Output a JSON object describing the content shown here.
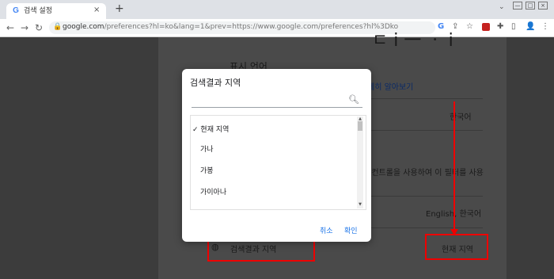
{
  "browser": {
    "tab_title": "검색 설정",
    "tab_favicon": "G",
    "close_glyph": "×",
    "new_tab_glyph": "+",
    "tab_search_glyph": "⌄",
    "window_controls": [
      "—",
      "□",
      "×"
    ],
    "nav": {
      "back": "←",
      "forward": "→",
      "reload": "↻"
    },
    "url_domain": "google.com",
    "url_rest": "/preferences?hl=ko&lang=1&prev=https://www.google.com/preferences?hl%3Dko",
    "toolbar_icons": [
      "G",
      "⇪",
      "☆",
      "❚",
      "✚",
      "▯",
      "👤",
      "⋮"
    ],
    "accent": "#1a73e8"
  },
  "page": {
    "heading_partial": "ㄷ ⅰ 一 ㆍ ⅰ",
    "section_label": "표시 언어",
    "learn_more": "세히 알아보기",
    "current_lang": "한국어",
    "filter_text": "e 컨트롤을 사용하여 이 필터를 사용",
    "search_langs": "English, 한국어",
    "region_label": "검색결과 지역",
    "region_value": "현재 지역"
  },
  "dialog": {
    "title": "검색결과 지역",
    "search_placeholder": "",
    "search_icon": "search-icon",
    "items": [
      {
        "label": "현재 지역",
        "checked": true
      },
      {
        "label": "가나",
        "checked": false
      },
      {
        "label": "가봉",
        "checked": false
      },
      {
        "label": "가이아나",
        "checked": false
      }
    ],
    "check_glyph": "✓",
    "cancel": "취소",
    "confirm": "확인"
  },
  "colors": {
    "annotation_red": "#e00000"
  }
}
